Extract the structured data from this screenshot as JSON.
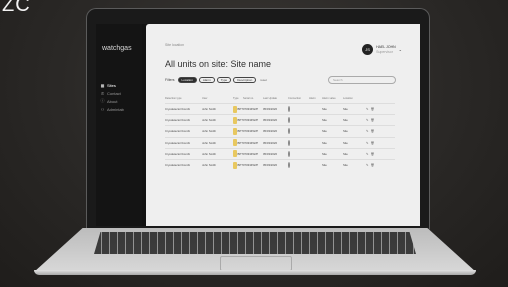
{
  "corner_text": "ZC",
  "app": {
    "logo_main": "watchgas",
    "logo_accent": "",
    "nav": [
      {
        "label": "Sites",
        "icon": "grid-icon",
        "active": true
      },
      {
        "label": "Contact",
        "icon": "phone-icon",
        "active": false
      },
      {
        "label": "About",
        "icon": "info-icon",
        "active": false
      },
      {
        "label": "Admintab",
        "icon": "user-icon",
        "active": false
      }
    ]
  },
  "header": {
    "breadcrumb": "Site location",
    "title": "All units on site: Site name",
    "user_initials": "JS",
    "user_name": "HAEL JOHN",
    "user_sub": "Supervisor"
  },
  "filters": {
    "label": "Filters",
    "chips": [
      {
        "label": "Location",
        "active": true
      },
      {
        "label": "Alarm",
        "active": false
      },
      {
        "label": "Type",
        "active": false
      },
      {
        "label": "Description",
        "active": false
      }
    ],
    "reset": "reset"
  },
  "search": {
    "placeholder": "Search"
  },
  "table": {
    "headers": [
      "Detection type",
      "User",
      "Type",
      "Serial no.",
      "Last Update",
      "Connection",
      "Alarm",
      "Alarm value",
      "Location",
      ""
    ],
    "rows": [
      {
        "detection": "Cryodetector/Combi",
        "user": "John Smith",
        "type": "BPT",
        "serial": "07033452/P",
        "updated": "05/03/2020",
        "alarm": false,
        "value": "Site",
        "location": "Site"
      },
      {
        "detection": "Cryodetector/Combi",
        "user": "John Smith",
        "type": "BPT",
        "serial": "07033452/P",
        "updated": "05/03/2020",
        "alarm": true,
        "value": "Site",
        "location": "Site"
      },
      {
        "detection": "Cryodetector/Combi",
        "user": "John Smith",
        "type": "BPT",
        "serial": "07033452/P",
        "updated": "05/03/2020",
        "alarm": false,
        "value": "Site",
        "location": "Site"
      },
      {
        "detection": "Cryodetector/Combi",
        "user": "John Smith",
        "type": "BPT",
        "serial": "07033452/P",
        "updated": "05/03/2020",
        "alarm": false,
        "value": "Site",
        "location": "Site"
      },
      {
        "detection": "Cryodetector/Combi",
        "user": "John Smith",
        "type": "BPT",
        "serial": "07033452/P",
        "updated": "05/03/2020",
        "alarm": true,
        "value": "Site",
        "location": "Site"
      },
      {
        "detection": "Cryodetector/Combi",
        "user": "John Smith",
        "type": "BPT",
        "serial": "07033452/P",
        "updated": "05/03/2020",
        "alarm": false,
        "value": "Site",
        "location": "Site"
      }
    ]
  },
  "colors": {
    "accent": "#2e2e2e",
    "alarm": "#cc2233",
    "unit": "#e8c860",
    "background": "#2a2826"
  }
}
